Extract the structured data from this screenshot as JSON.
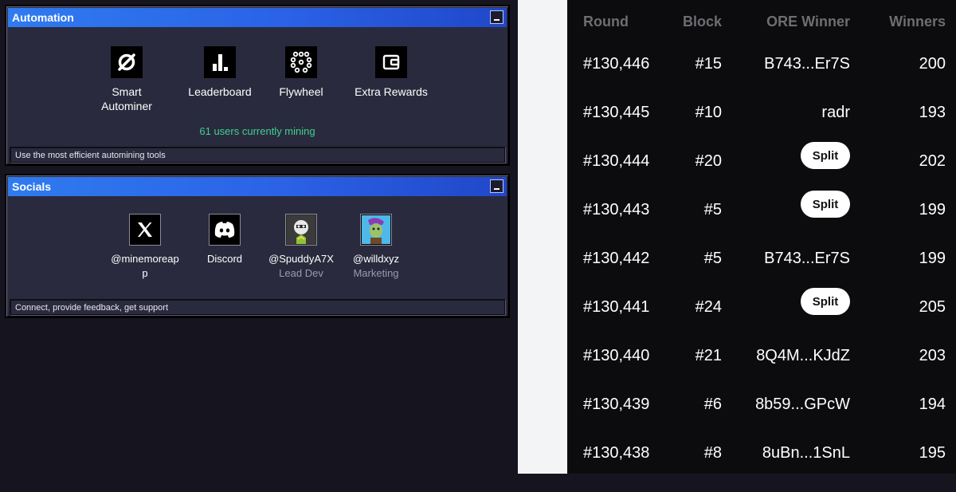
{
  "automation": {
    "title": "Automation",
    "tiles": [
      {
        "label": "Smart Autominer",
        "icon": "autominer-icon"
      },
      {
        "label": "Leaderboard",
        "icon": "bar-chart-icon"
      },
      {
        "label": "Flywheel",
        "icon": "flywheel-icon"
      },
      {
        "label": "Extra Rewards",
        "icon": "wallet-icon"
      }
    ],
    "status": "61 users currently mining",
    "footer": "Use the most efficient automining tools"
  },
  "socials": {
    "title": "Socials",
    "tiles": [
      {
        "label": "@minemoreapp",
        "sub": "",
        "icon": "x-logo-icon"
      },
      {
        "label": "Discord",
        "sub": "",
        "icon": "discord-icon"
      },
      {
        "label": "@SpuddyA7X",
        "sub": "Lead Dev",
        "icon": "avatar-icon"
      },
      {
        "label": "@willdxyz",
        "sub": "Marketing",
        "icon": "avatar-icon"
      }
    ],
    "footer": "Connect, provide feedback, get support"
  },
  "rounds_table": {
    "headers": {
      "round": "Round",
      "block": "Block",
      "winner": "ORE Winner",
      "winners": "Winners"
    },
    "rows": [
      {
        "round": "#130,446",
        "block": "#15",
        "winner": "B743...Er7S",
        "winners": "200"
      },
      {
        "round": "#130,445",
        "block": "#10",
        "winner": "radr",
        "winners": "193"
      },
      {
        "round": "#130,444",
        "block": "#20",
        "winner": "Split",
        "winners": "202"
      },
      {
        "round": "#130,443",
        "block": "#5",
        "winner": "Split",
        "winners": "199"
      },
      {
        "round": "#130,442",
        "block": "#5",
        "winner": "B743...Er7S",
        "winners": "199"
      },
      {
        "round": "#130,441",
        "block": "#24",
        "winner": "Split",
        "winners": "205"
      },
      {
        "round": "#130,440",
        "block": "#21",
        "winner": "8Q4M...KJdZ",
        "winners": "203"
      },
      {
        "round": "#130,439",
        "block": "#6",
        "winner": "8b59...GPcW",
        "winners": "194"
      },
      {
        "round": "#130,438",
        "block": "#8",
        "winner": "8uBn...1SnL",
        "winners": "195"
      }
    ]
  },
  "colors": {
    "titlebar": "#2b62e6",
    "window_bg": "#2a2a3e",
    "status_green": "#3fd18d",
    "table_bg": "#0c0c0e"
  }
}
